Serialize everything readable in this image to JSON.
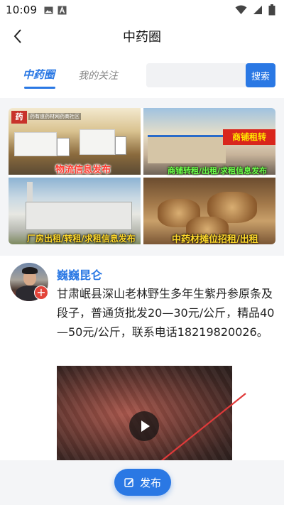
{
  "status_bar": {
    "time": "10:09",
    "left_icons": [
      "image-icon",
      "font-a-icon"
    ],
    "right_icons": [
      "wifi-icon",
      "signal-icon",
      "battery-icon"
    ]
  },
  "header": {
    "title": "中药圈",
    "back_icon": "chevron-left-icon"
  },
  "tabs": [
    {
      "label": "中药圈",
      "active": true
    },
    {
      "label": "我的关注",
      "active": false
    }
  ],
  "search": {
    "placeholder": "",
    "value": "",
    "button_label": "搜索"
  },
  "banner": {
    "logo_text": "药有道药材网药商社区",
    "logo_mark": "药",
    "tiles": [
      {
        "caption": "物流信息发布"
      },
      {
        "caption": "商铺转租/出租/求租信息发布",
        "sign": "商铺租转"
      },
      {
        "caption": "厂房出租/转租/求租信息发布"
      },
      {
        "caption": "中药材摊位招租/出租"
      }
    ]
  },
  "post": {
    "author": "巍巍昆仑",
    "follow_symbol": "+",
    "text": "甘肃岷县深山老林野生多年生紫丹参原条及段子，普通货批发20—30元/公斤，精品40—50元/公斤，联系电话18219820026。",
    "video_play_icon": "play-icon"
  },
  "bottom": {
    "publish_label": "发布",
    "publish_icon": "edit-icon"
  },
  "colors": {
    "accent": "#2a78e4",
    "badge": "#e3443a",
    "annotation_arrow": "#e03a3a"
  }
}
